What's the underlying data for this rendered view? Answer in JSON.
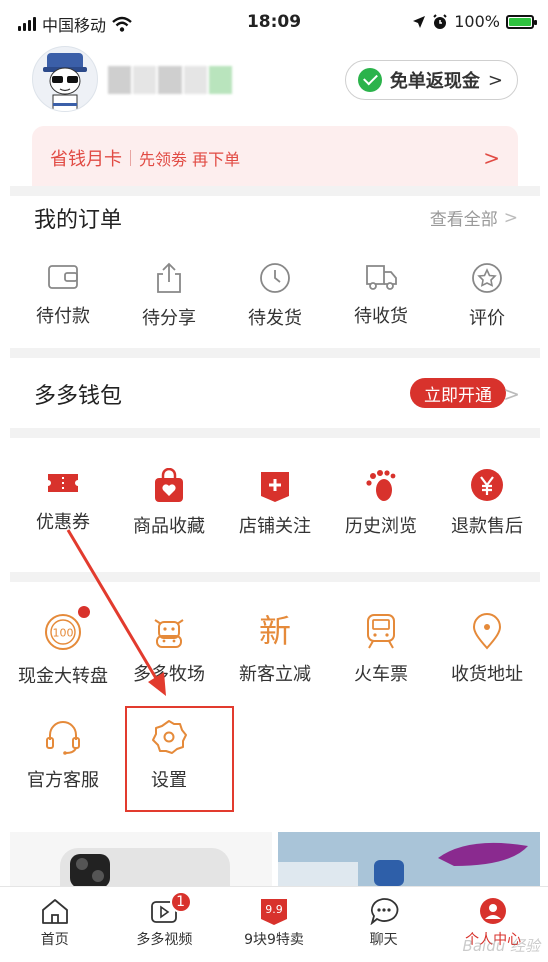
{
  "status": {
    "carrier": "中国移动",
    "time": "18:09",
    "battery": "100%",
    "battery_level": 1.0
  },
  "profile": {
    "cash_pill": "免单返现金",
    "cash_pill_chevron": ">"
  },
  "month_card": {
    "title": "省钱月卡",
    "subtitle": "先领劵 再下单",
    "chevron": ">"
  },
  "orders": {
    "title": "我的订单",
    "view_all": "查看全部",
    "chevron": ">",
    "items": [
      {
        "label": "待付款",
        "icon": "wallet-icon"
      },
      {
        "label": "待分享",
        "icon": "share-icon"
      },
      {
        "label": "待发货",
        "icon": "clock-icon"
      },
      {
        "label": "待收货",
        "icon": "truck-icon"
      },
      {
        "label": "评价",
        "icon": "star-badge-icon"
      }
    ]
  },
  "wallet": {
    "title": "多多钱包",
    "button": "立即开通",
    "chevron": ">"
  },
  "shortcuts": [
    {
      "label": "优惠券",
      "icon": "ticket-icon"
    },
    {
      "label": "商品收藏",
      "icon": "bag-heart-icon"
    },
    {
      "label": "店铺关注",
      "icon": "shop-plus-icon"
    },
    {
      "label": "历史浏览",
      "icon": "footprint-icon"
    },
    {
      "label": "退款售后",
      "icon": "yuan-icon"
    }
  ],
  "services": {
    "row1": [
      {
        "label": "现金大转盘",
        "icon": "wheel-100-icon",
        "text": "100"
      },
      {
        "label": "多多牧场",
        "icon": "cow-icon"
      },
      {
        "label": "新客立减",
        "icon": "new-icon",
        "text": "新"
      },
      {
        "label": "火车票",
        "icon": "train-icon"
      },
      {
        "label": "收货地址",
        "icon": "location-icon"
      }
    ],
    "row2": [
      {
        "label": "官方客服",
        "icon": "headset-icon"
      },
      {
        "label": "设置",
        "icon": "gear-icon"
      }
    ]
  },
  "tabbar": [
    {
      "label": "首页",
      "icon": "home-icon"
    },
    {
      "label": "多多视频",
      "icon": "video-icon",
      "badge": "1"
    },
    {
      "label": "9块9特卖",
      "icon": "sale-99-icon",
      "text": "9.9"
    },
    {
      "label": "聊天",
      "icon": "chat-icon"
    },
    {
      "label": "个人中心",
      "icon": "profile-icon"
    }
  ],
  "watermark": "Baidu 经验",
  "colors": {
    "accent": "#d8322c",
    "icon_orange": "#e58a3a",
    "highlight": "#e23b2e"
  }
}
